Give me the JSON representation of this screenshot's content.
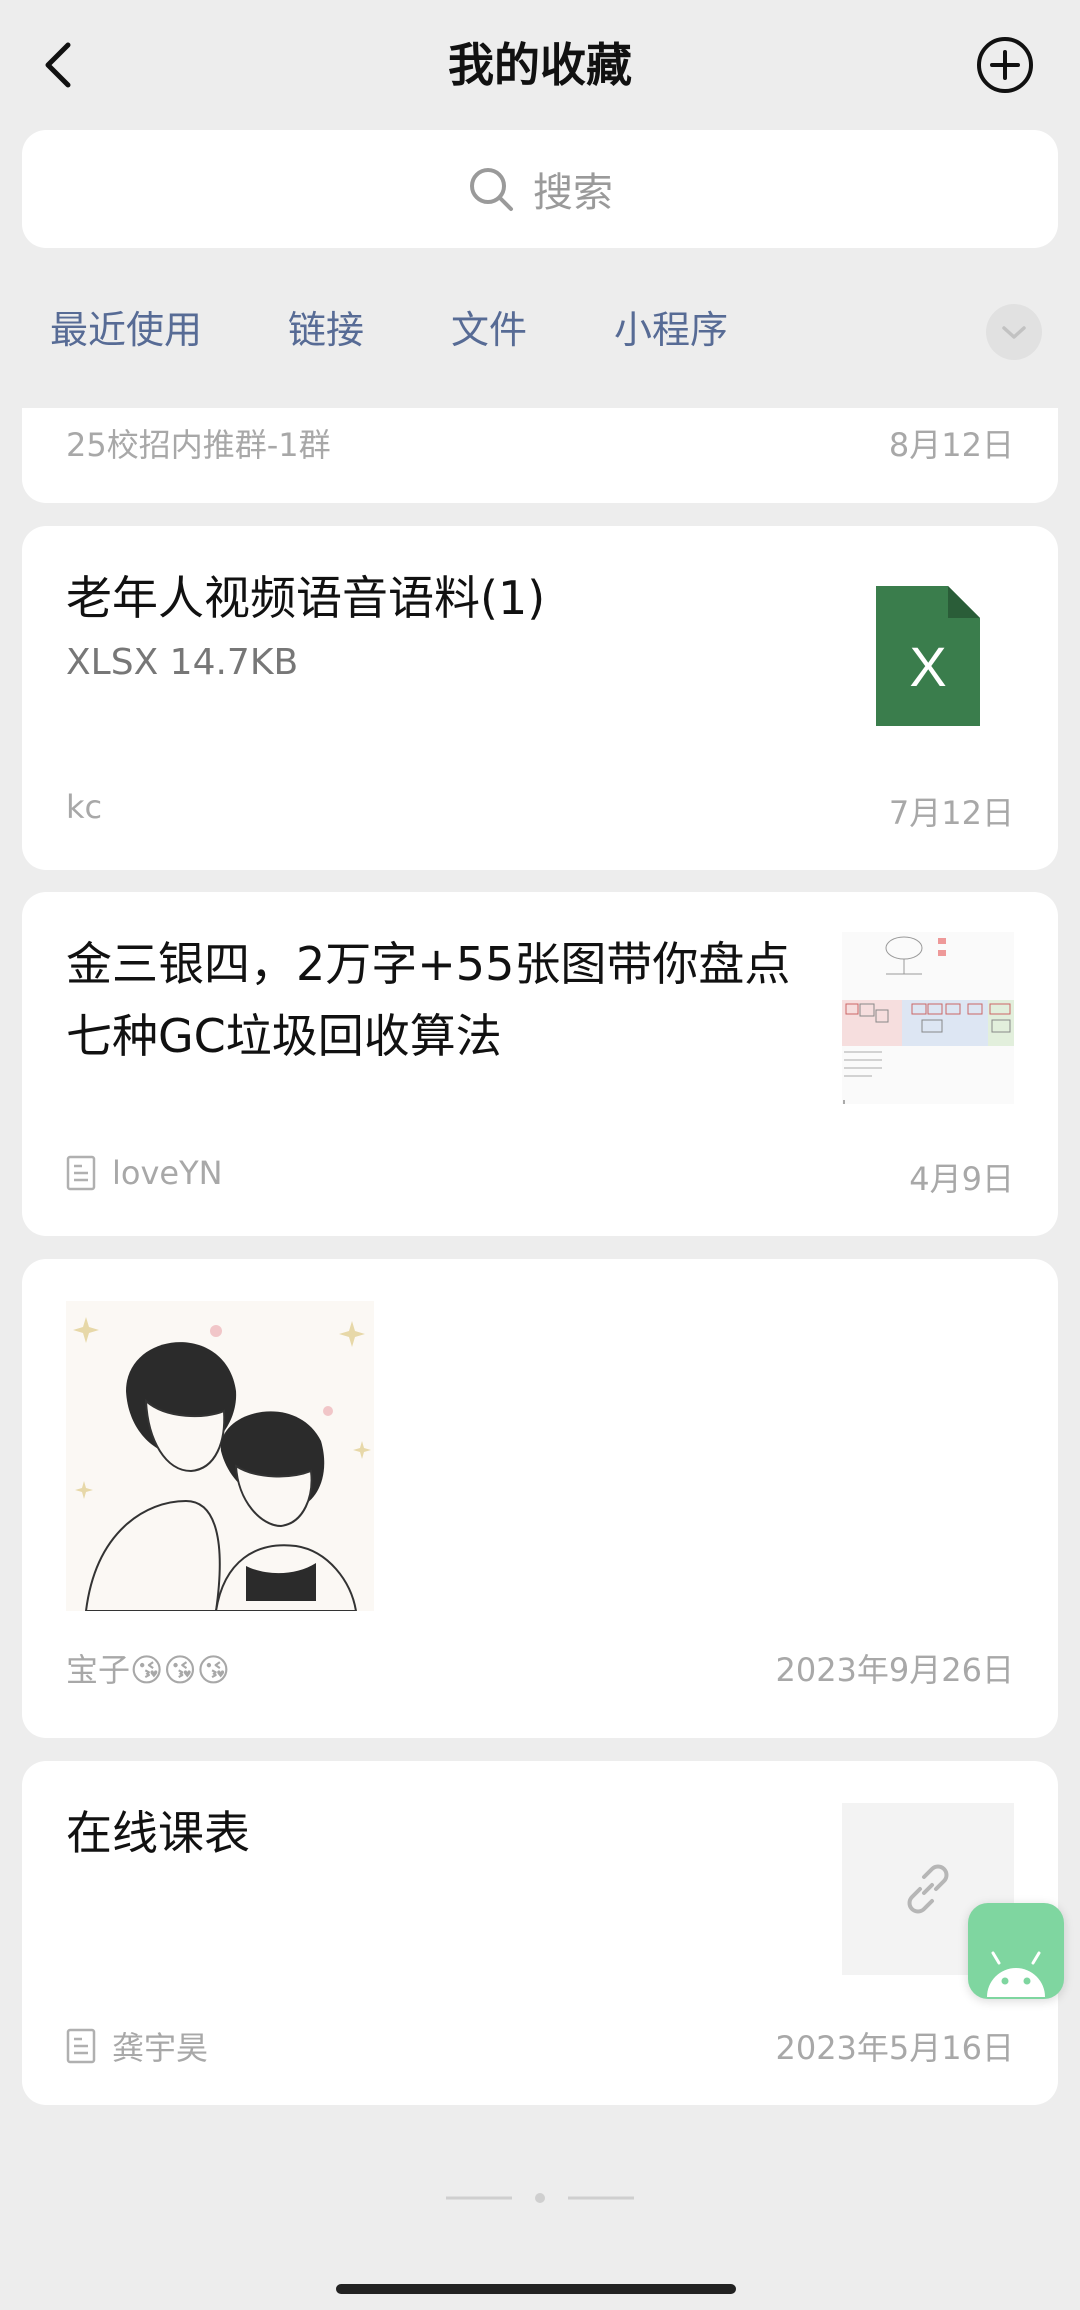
{
  "header": {
    "title": "我的收藏"
  },
  "search": {
    "placeholder": "搜索"
  },
  "tabs": [
    "最近使用",
    "链接",
    "文件",
    "小程序"
  ],
  "items": [
    {
      "source": "25校招内推群-1群",
      "date": "8月12日"
    },
    {
      "title": "老年人视频语音语料(1)",
      "subtitle": "XLSX 14.7KB",
      "source": "kc",
      "date": "7月12日",
      "icon": "excel-file-icon",
      "icon_letter": "X",
      "icon_color": "#3a7d4c"
    },
    {
      "title_lines": [
        "金三银四，2万字+55张图带你盘点",
        "七种GC垃圾回收算法"
      ],
      "source": "loveYN",
      "date": "4月9日"
    },
    {
      "source": "宝子😘😘😘",
      "date": "2023年9月26日"
    },
    {
      "title": "在线课表",
      "source": "龚宇昊",
      "date": "2023年5月16日"
    }
  ],
  "colors": {
    "accent": "#576b95",
    "background": "#ededed",
    "excel_green": "#3a7d4c",
    "fab_green": "#7fd6a0"
  }
}
